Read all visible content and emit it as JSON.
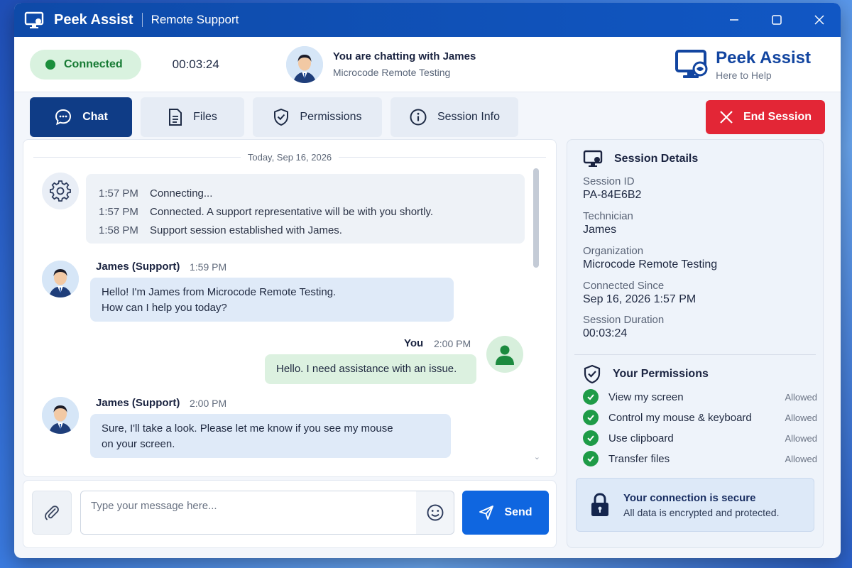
{
  "titlebar": {
    "app_name": "Peek Assist",
    "subtitle": "Remote Support"
  },
  "status": {
    "connection": "Connected",
    "timer": "00:03:24",
    "chatting_with": "You are chatting with James",
    "organization": "Microcode Remote Testing"
  },
  "brand": {
    "name": "Peek Assist",
    "tagline": "Here to Help"
  },
  "tabs": [
    {
      "label": "Chat",
      "icon": "chat-icon",
      "active": true
    },
    {
      "label": "Files",
      "icon": "file-icon",
      "active": false
    },
    {
      "label": "Permissions",
      "icon": "shield-icon",
      "active": false
    },
    {
      "label": "Session Info",
      "icon": "info-icon",
      "active": false
    }
  ],
  "end_session_label": "End Session",
  "chat": {
    "date": "Today, Sep 16, 2026",
    "system_events": [
      {
        "time": "1:57 PM",
        "text": "Connecting..."
      },
      {
        "time": "1:57 PM",
        "text": "Connected. A support representative will be with you shortly."
      },
      {
        "time": "1:58 PM",
        "text": "Support session established with James."
      }
    ],
    "messages": [
      {
        "sender": "James (Support)",
        "time": "1:59 PM",
        "line1": "Hello! I'm James from Microcode Remote Testing.",
        "line2": "How can I help you today?"
      },
      {
        "sender": "You",
        "time": "2:00 PM",
        "line1": "Hello. I need assistance with an issue."
      },
      {
        "sender": "James (Support)",
        "time": "2:00 PM",
        "line1": "Sure, I'll take a look. Please let me know if you see my mouse",
        "line2": "on your screen."
      }
    ]
  },
  "composer": {
    "placeholder": "Type your message here...",
    "send_label": "Send"
  },
  "session_details": {
    "heading": "Session Details",
    "items": [
      {
        "label": "Session ID",
        "value": "PA-84E6B2"
      },
      {
        "label": "Technician",
        "value": "James"
      },
      {
        "label": "Organization",
        "value": "Microcode Remote Testing"
      },
      {
        "label": "Connected Since",
        "value": "Sep 16, 2026 1:57 PM"
      },
      {
        "label": "Session Duration",
        "value": "00:03:24"
      }
    ]
  },
  "permissions": {
    "heading": "Your Permissions",
    "items": [
      {
        "label": "View my screen",
        "status": "Allowed"
      },
      {
        "label": "Control my mouse & keyboard",
        "status": "Allowed"
      },
      {
        "label": "Use clipboard",
        "status": "Allowed"
      },
      {
        "label": "Transfer files",
        "status": "Allowed"
      }
    ]
  },
  "secure": {
    "title": "Your connection is secure",
    "subtitle": "All data is encrypted and protected."
  },
  "colors": {
    "primary": "#0f3c86",
    "accent": "#0f66e0",
    "danger": "#e32636",
    "success": "#1e9b47"
  }
}
